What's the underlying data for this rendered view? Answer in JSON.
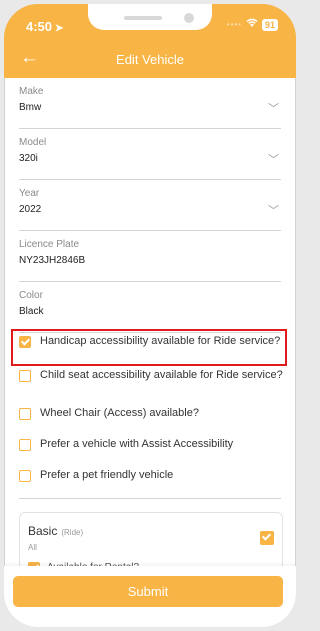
{
  "status": {
    "time": "4:50",
    "battery": "91"
  },
  "header": {
    "title": "Edit Vehicle"
  },
  "fields": {
    "make": {
      "label": "Make",
      "value": "Bmw"
    },
    "model": {
      "label": "Model",
      "value": "320i"
    },
    "year": {
      "label": "Year",
      "value": "2022"
    },
    "plate": {
      "label": "Licence Plate",
      "value": "NY23JH2846B"
    },
    "color": {
      "label": "Color",
      "value": "Black"
    }
  },
  "accessibility": [
    {
      "label": "Handicap accessibility available for Ride service?",
      "checked": true
    },
    {
      "label": "Child seat accessibility available for Ride service?",
      "checked": false
    },
    {
      "label": "Wheel Chair (Access) available?",
      "checked": false
    },
    {
      "label": "Prefer a vehicle with Assist Accessibility",
      "checked": false
    },
    {
      "label": "Prefer a pet friendly vehicle",
      "checked": false
    }
  ],
  "service_card": {
    "title": "Basic",
    "tag": "(Ride)",
    "subtitle": "All",
    "checked": true,
    "rental_label": "Available for Rental?",
    "rental_checked": true
  },
  "submit_label": "Submit",
  "colors": {
    "accent": "#f8b445",
    "highlight": "#e01b1b"
  },
  "icons": {
    "back": "arrow-left-icon",
    "location": "location-arrow-icon",
    "dropdown": "chevron-down-icon",
    "wifi": "wifi-icon"
  }
}
